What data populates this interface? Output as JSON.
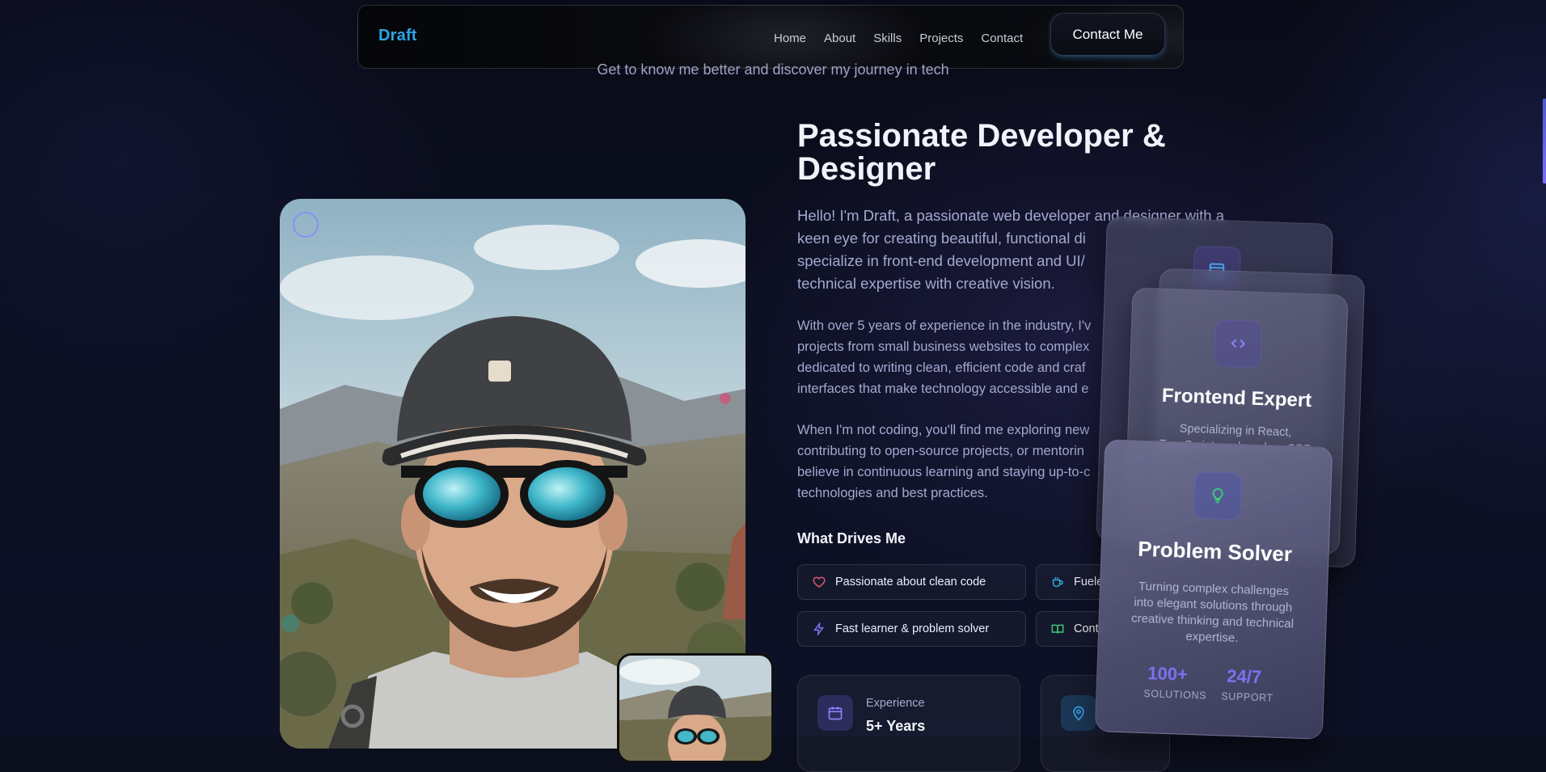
{
  "nav": {
    "brand": "Draft",
    "links": [
      "Home",
      "About",
      "Skills",
      "Projects",
      "Contact"
    ],
    "cta": "Contact Me"
  },
  "about": {
    "subtitle": "Get to know me better and discover my journey in tech",
    "title_line1": "Passionate Developer &",
    "title_line2": "Designer",
    "paragraphs": [
      "Hello! I'm Draft, a passionate web developer and designer with a keen eye for creating beautiful, functional di specialize in front-end development and UI/ technical expertise with creative vision.",
      "With over 5 years of experience in the industry, I'v projects from small business websites to complex dedicated to writing clean, efficient code and craf interfaces that make technology accessible and e",
      "When I'm not coding, you'll find me exploring new contributing to open-source projects, or mentorin believe in continuous learning and staying up-to-c technologies and best practices."
    ],
    "p1_lines": [
      "Hello! I'm Draft, a passionate web developer and designer with a",
      "keen eye for creating beautiful, functional di",
      "specialize in front-end development and UI/",
      "technical expertise with creative vision."
    ],
    "p2_lines": [
      "With over 5 years of experience in the industry, I'v",
      "projects from small business websites to complex",
      "dedicated to writing clean, efficient code and craf",
      "interfaces that make technology accessible and e"
    ],
    "p3_lines": [
      "When I'm not coding, you'll find me exploring new",
      "contributing to open-source projects, or mentorin",
      "believe in continuous learning and staying up-to-c",
      "technologies and best practices."
    ],
    "drives_title": "What Drives Me",
    "traits": [
      {
        "label": "Passionate about clean code",
        "icon": "heart-icon",
        "color": "#e0557a"
      },
      {
        "label": "Fuele",
        "icon": "coffee-icon",
        "color": "#2ab0e0"
      },
      {
        "label": "Fast learner & problem solver",
        "icon": "bolt-icon",
        "color": "#7b73f2"
      },
      {
        "label": "Conti",
        "icon": "book-icon",
        "color": "#3cc97a"
      }
    ],
    "stats": [
      {
        "label": "Experience",
        "value": "5+ Years",
        "icon": "calendar-icon",
        "color": "#8c84ff"
      },
      {
        "label": "",
        "value": "",
        "icon": "location-icon",
        "color": "#3aa0e8"
      }
    ]
  },
  "cards": {
    "frontend": {
      "title": "Frontend Expert",
      "desc_line1": "Specializing in React,",
      "desc_line2": "TypeScript, and modern CSS",
      "icon": "code-icon"
    },
    "problem": {
      "title": "Problem Solver",
      "desc_lines": [
        "Turning complex challenges",
        "into elegant solutions through",
        "creative thinking and technical",
        "expertise."
      ],
      "icon": "lightbulb-icon",
      "stat1_value": "100+",
      "stat1_label": "SOLUTIONS",
      "stat2_value": "24/7",
      "stat2_label": "SUPPORT"
    },
    "back_icon": "window-icon"
  },
  "colors": {
    "brand": "#2ba6e8",
    "accent": "#7b73f2",
    "background": "#0b0e1d"
  }
}
